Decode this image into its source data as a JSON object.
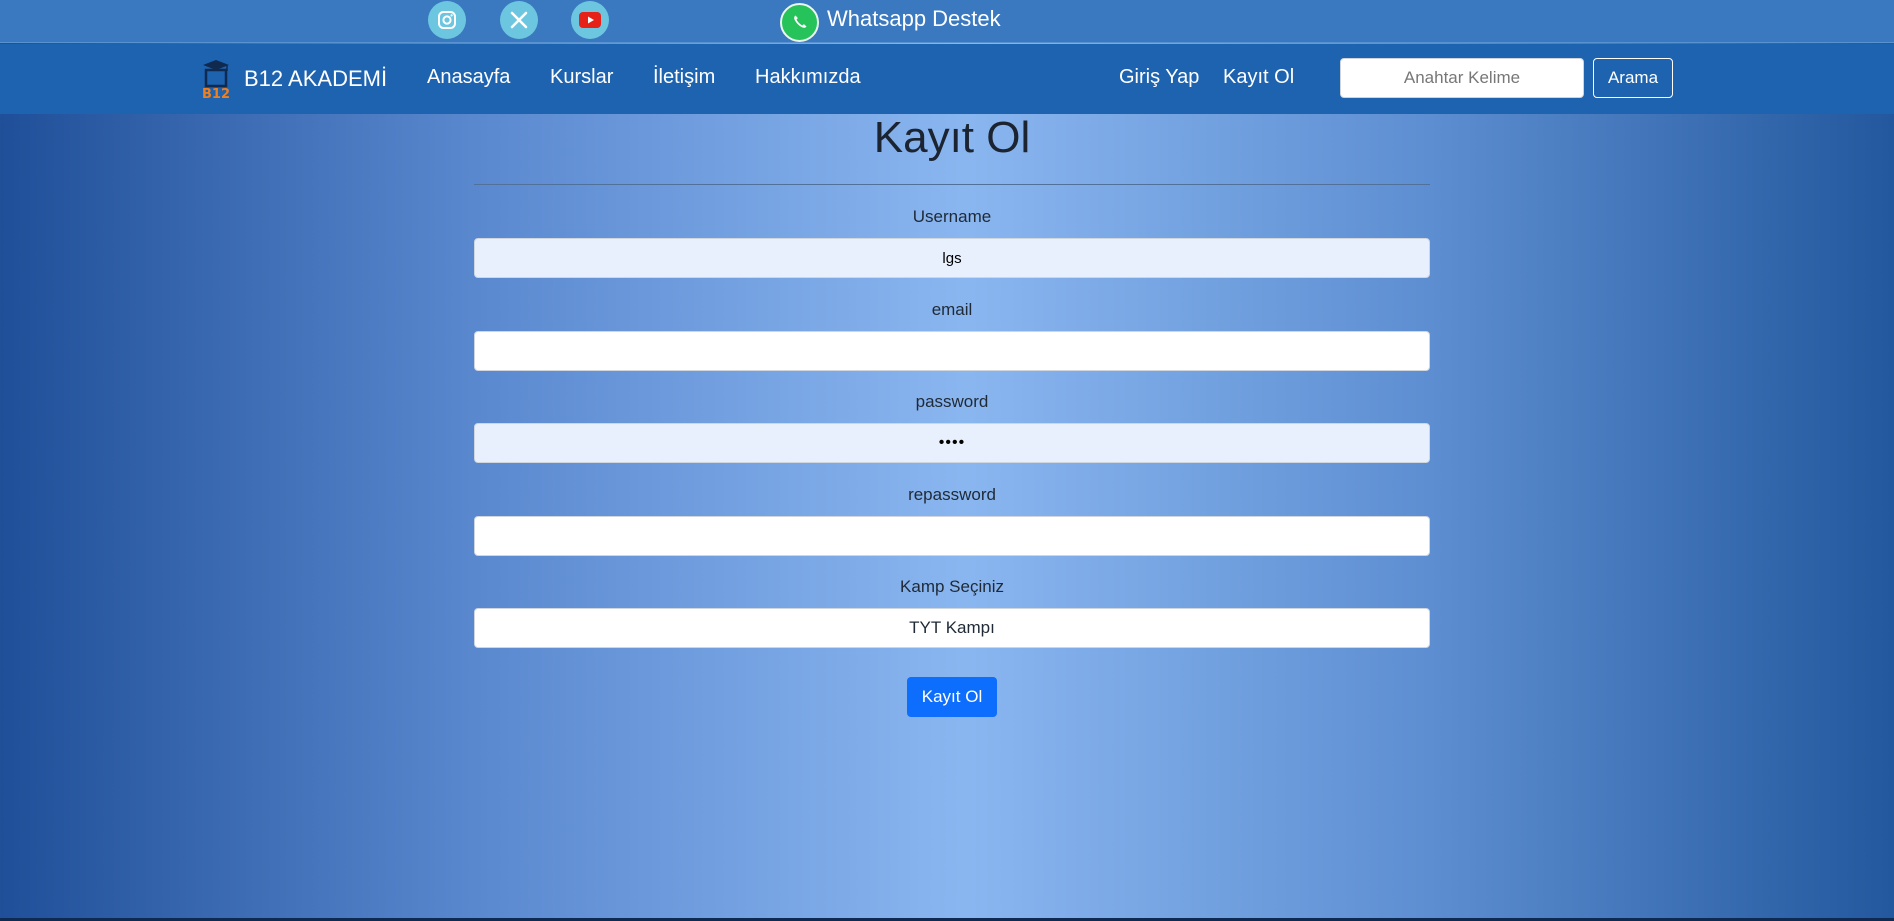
{
  "topbar": {
    "social_icons": [
      "instagram-icon",
      "x-twitter-icon",
      "youtube-icon"
    ],
    "whatsapp_label": "Whatsapp Destek"
  },
  "navbar": {
    "brand": "B12 AKADEMİ",
    "logo_text": "B12",
    "links": [
      "Anasayfa",
      "Kurslar",
      "İletişim",
      "Hakkımızda"
    ],
    "auth_links": [
      "Giriş Yap",
      "Kayıt Ol"
    ],
    "search_placeholder": "Anahtar Kelime",
    "search_button": "Arama"
  },
  "form": {
    "title": "Kayıt Ol",
    "username_label": "Username",
    "username_value": "lgs",
    "email_label": "email",
    "email_value": "",
    "password_label": "password",
    "password_value": "••••",
    "repassword_label": "repassword",
    "repassword_value": "",
    "camp_label": "Kamp Seçiniz",
    "camp_selected": "TYT Kampı",
    "submit_label": "Kayıt Ol"
  },
  "colors": {
    "navbar": "#1e63b0",
    "topbar": "#3a78bf",
    "social_bg": "#6cc6e0",
    "whatsapp": "#25c35a",
    "primary_button": "#0d6efd"
  }
}
